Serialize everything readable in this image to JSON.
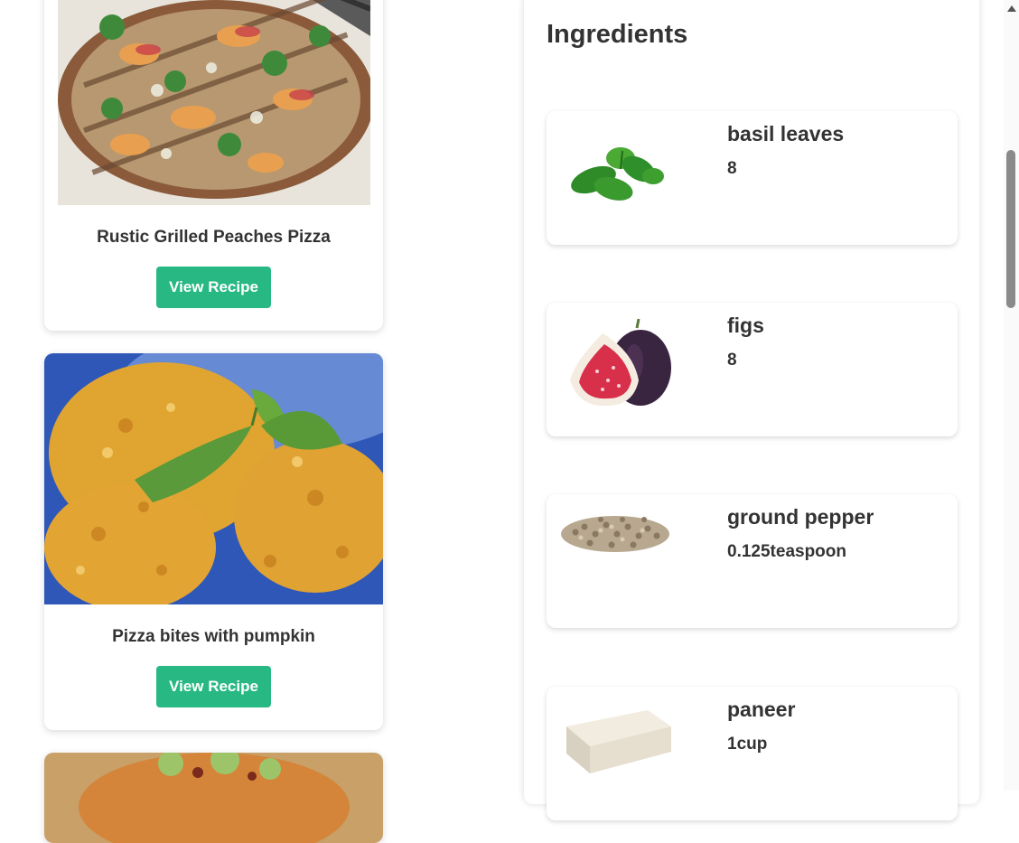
{
  "recipes": [
    {
      "title": "Rustic Grilled Peaches Pizza",
      "button_label": "View Recipe"
    },
    {
      "title": "Pizza bites with pumpkin",
      "button_label": "View Recipe"
    },
    {
      "title": "",
      "button_label": ""
    }
  ],
  "ingredients": {
    "heading": "Ingredients",
    "items": [
      {
        "name": "basil leaves",
        "amount": "8",
        "icon": "basil-image"
      },
      {
        "name": "figs",
        "amount": "8",
        "icon": "figs-image"
      },
      {
        "name": "ground pepper",
        "amount": "0.125teaspoon",
        "icon": "peppercorn-image"
      },
      {
        "name": "paneer",
        "amount": "1cup",
        "icon": "paneer-image"
      }
    ]
  },
  "colors": {
    "accent_button": "#27b884",
    "text": "#333333"
  }
}
